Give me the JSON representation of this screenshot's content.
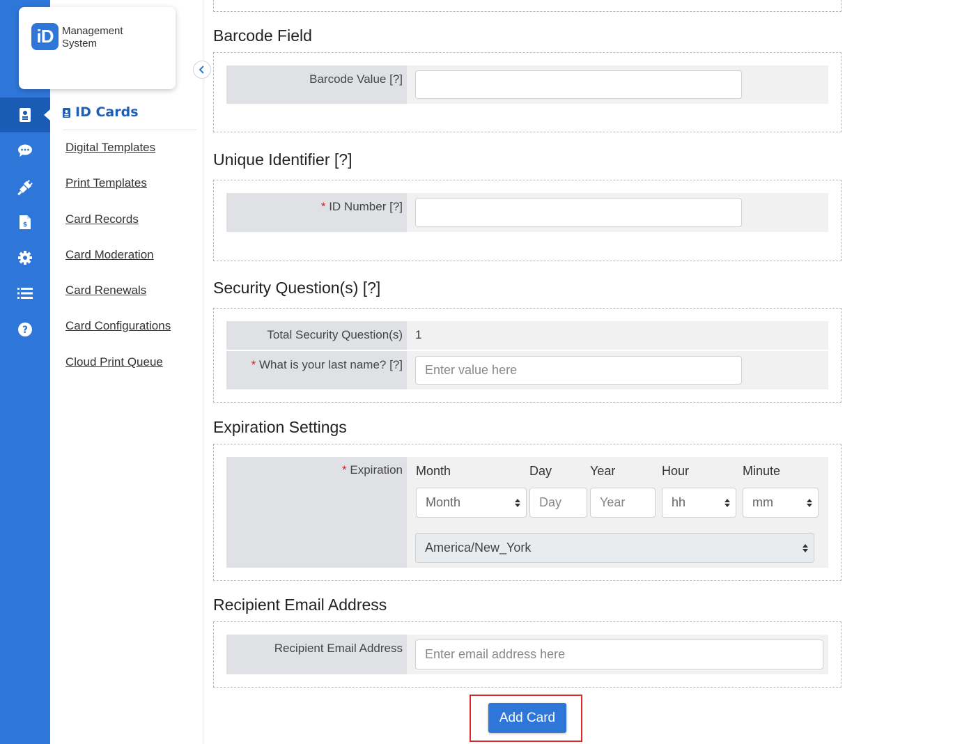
{
  "brand": {
    "badge": "iD",
    "line1": "Management",
    "line2": "System"
  },
  "rail": {
    "icons": [
      "id-card-icon",
      "chat-icon",
      "plug-icon",
      "invoice-icon",
      "gear-icon",
      "list-icon",
      "help-icon"
    ],
    "active_index": 0,
    "colors": {
      "background": "#2f76d9",
      "active": "#1a5bb5"
    }
  },
  "subnav": {
    "title": "ID Cards",
    "links": [
      "Digital Templates",
      "Print Templates",
      "Card Records",
      "Card Moderation",
      "Card Renewals",
      "Card Configurations",
      "Cloud Print Queue"
    ]
  },
  "sections": {
    "barcode": {
      "title": "Barcode Field",
      "label": "Barcode Value [?]",
      "value": ""
    },
    "unique": {
      "title": "Unique Identifier [?]",
      "required_mark": "*",
      "label": "ID Number [?]",
      "value": ""
    },
    "security": {
      "title": "Security Question(s) [?]",
      "total_label": "Total Security Question(s)",
      "total_value": "1",
      "required_mark": "*",
      "question_label": "What is your last name? [?]",
      "answer_placeholder": "Enter value here"
    },
    "expiration": {
      "title": "Expiration Settings",
      "required_mark": "*",
      "label": "Expiration",
      "columns": {
        "month": "Month",
        "day": "Day",
        "year": "Year",
        "hour": "Hour",
        "minute": "Minute"
      },
      "month_selected": "Month",
      "day_placeholder": "Day",
      "year_placeholder": "Year",
      "hour_selected": "hh",
      "minute_selected": "mm",
      "timezone": "America/New_York"
    },
    "email": {
      "title": "Recipient Email Address",
      "label": "Recipient Email Address",
      "placeholder": "Enter email address here"
    }
  },
  "actions": {
    "add_card": "Add Card"
  },
  "colors": {
    "accent": "#2f76d9",
    "required": "#d42020",
    "highlight": "#d62a2a"
  }
}
